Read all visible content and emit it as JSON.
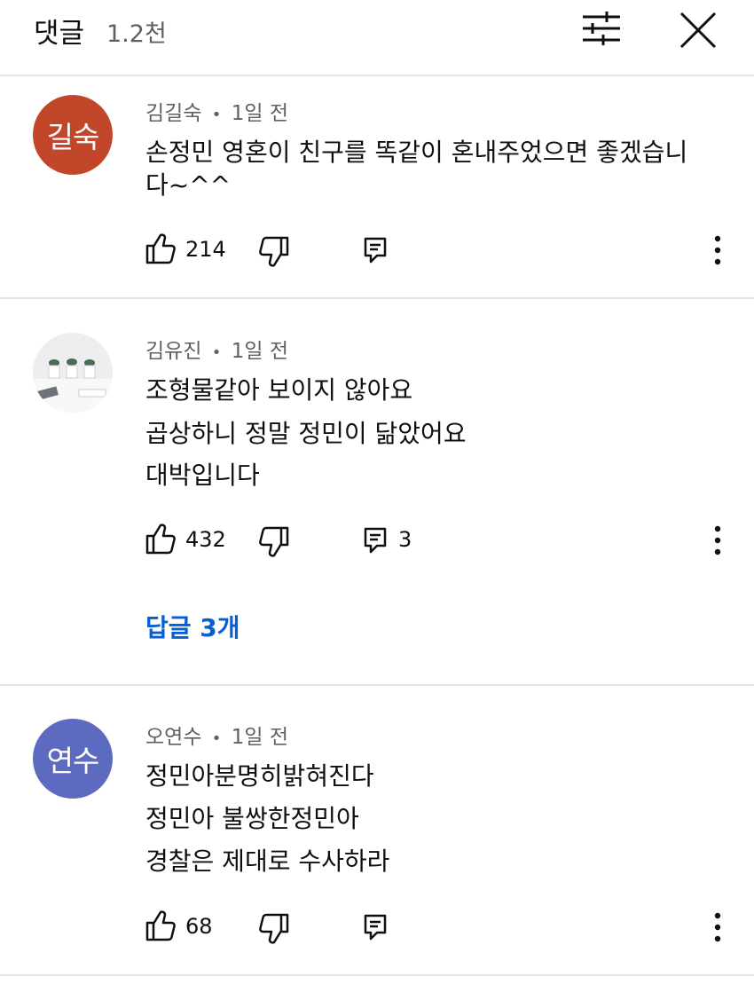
{
  "header": {
    "title": "댓글",
    "count": "1.2천"
  },
  "comments": [
    {
      "author": "김길숙",
      "time": "1일 전",
      "avatar_text": "길숙",
      "avatar_color": "#c2472a",
      "lines": [
        "손정민 영혼이 친구를 똑같이 혼내주었으면 좋겠습니",
        "다~^^"
      ],
      "likes": "214",
      "replies": ""
    },
    {
      "author": "김유진",
      "time": "1일 전",
      "avatar_text": "",
      "avatar_color": "#eceef0",
      "lines": [
        "조형물같아 보이지 않아요",
        "곱상하니 정말 정민이 닮았어요",
        "대박입니다"
      ],
      "likes": "432",
      "replies": "3",
      "replies_link": "답글 3개"
    },
    {
      "author": "오연수",
      "time": "1일 전",
      "avatar_text": "연수",
      "avatar_color": "#5c6bc0",
      "lines": [
        "정민아분명히밝혀진다",
        "정민아 불쌍한정민아",
        "경찰은 제대로 수사하라"
      ],
      "likes": "68",
      "replies": ""
    }
  ],
  "separator": "•"
}
